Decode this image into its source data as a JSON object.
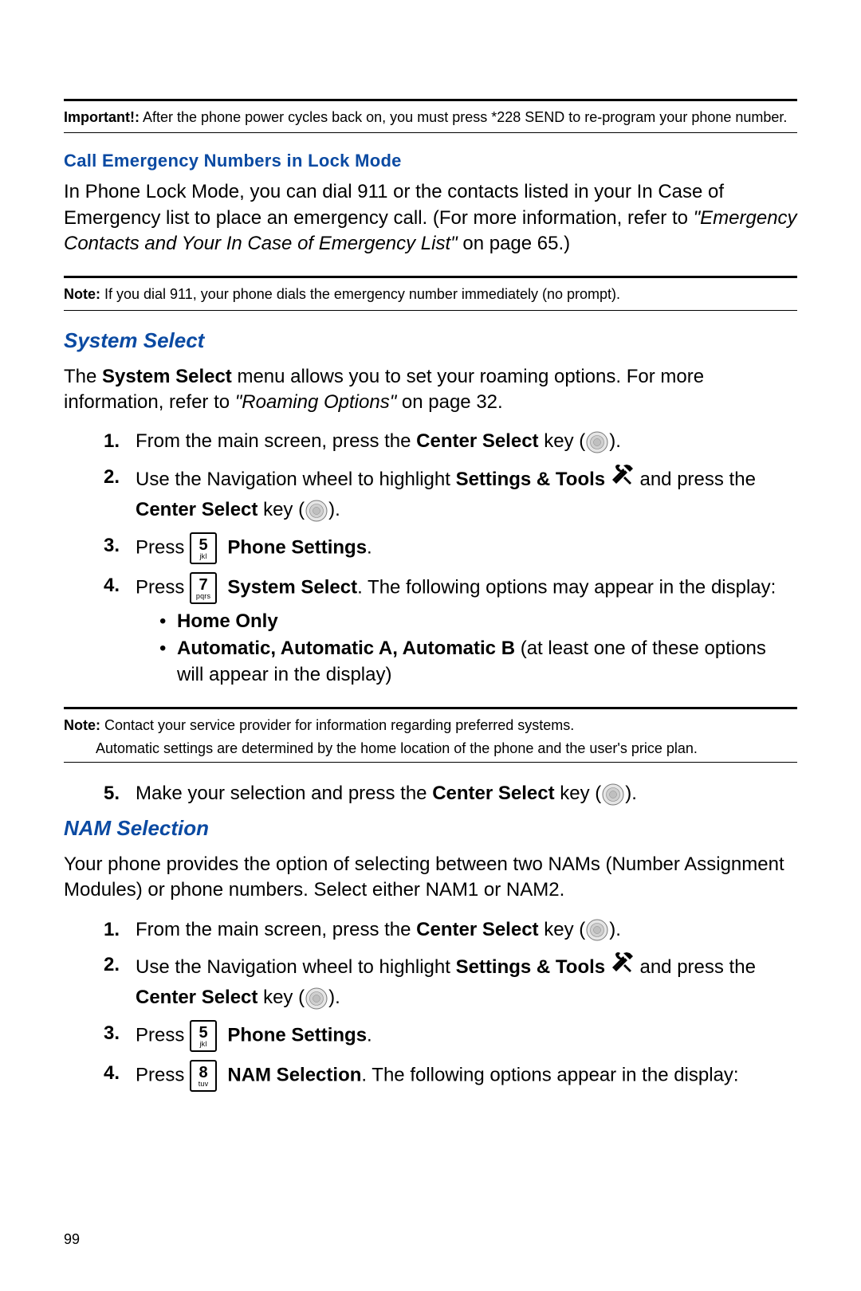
{
  "page_number": "99",
  "important": {
    "label": "Important!:",
    "text": " After the phone power cycles back on, you must press *228 SEND to re-program your phone number."
  },
  "sec1": {
    "heading": "Call Emergency Numbers in Lock Mode",
    "body_a": "In Phone Lock Mode, you can dial 911 or the contacts listed in your In Case of Emergency list to place an emergency call. (For more information, refer to ",
    "body_ref": "\"Emergency Contacts and Your In Case of Emergency List\"",
    "body_b": "  on page 65.)",
    "note_label": "Note:",
    "note_text": " If you dial 911, your phone dials the emergency number immediately (no prompt)."
  },
  "sec2": {
    "heading": "System Select",
    "intro_a": "The ",
    "intro_b": "System Select",
    "intro_c": " menu allows you to set your roaming options. For more information, refer to ",
    "intro_ref": "\"Roaming Options\"",
    "intro_d": "  on page 32.",
    "s1_a": "From the main screen, press the ",
    "s1_b": "Center Select",
    "s1_c": " key (",
    "s1_d": ").",
    "s2_a": "Use the Navigation wheel to highlight ",
    "s2_b": "Settings & Tools",
    "s2_c": " and press the ",
    "s2_d": "Center Select",
    "s2_e": " key (",
    "s2_f": ").",
    "s3_a": "Press ",
    "s3_key_num": "5",
    "s3_key_sub": "jkl",
    "s3_b": "Phone Settings",
    "s3_c": ".",
    "s4_a": "Press ",
    "s4_key_num": "7",
    "s4_key_sub": "pqrs",
    "s4_b": "System Select",
    "s4_c": ". The following options may appear in the display:",
    "b1": "Home Only",
    "b2_a": "Automatic, Automatic A, Automatic B",
    "b2_b": " (at least one of these options will appear in the display)",
    "note_label": "Note:",
    "note_text": " Contact your service provider for information regarding preferred systems.",
    "note2": "Automatic settings are determined by the home location of the phone and the user's price plan.",
    "s5_a": "Make your selection and press the ",
    "s5_b": "Center Select",
    "s5_c": " key (",
    "s5_d": ")."
  },
  "sec3": {
    "heading": "NAM Selection",
    "intro": "Your phone provides the option of selecting between two NAMs (Number Assignment Modules) or phone numbers. Select either NAM1 or NAM2.",
    "s1_a": "From the main screen, press the ",
    "s1_b": "Center Select",
    "s1_c": " key (",
    "s1_d": ").",
    "s2_a": "Use the Navigation wheel to highlight ",
    "s2_b": "Settings & Tools",
    "s2_c": " and press the ",
    "s2_d": "Center Select",
    "s2_e": " key (",
    "s2_f": ").",
    "s3_a": "Press ",
    "s3_key_num": "5",
    "s3_key_sub": "jkl",
    "s3_b": "Phone Settings",
    "s3_c": ".",
    "s4_a": "Press ",
    "s4_key_num": "8",
    "s4_key_sub": "tuv",
    "s4_b": "NAM Selection",
    "s4_c": ". The following options appear in the display:"
  }
}
